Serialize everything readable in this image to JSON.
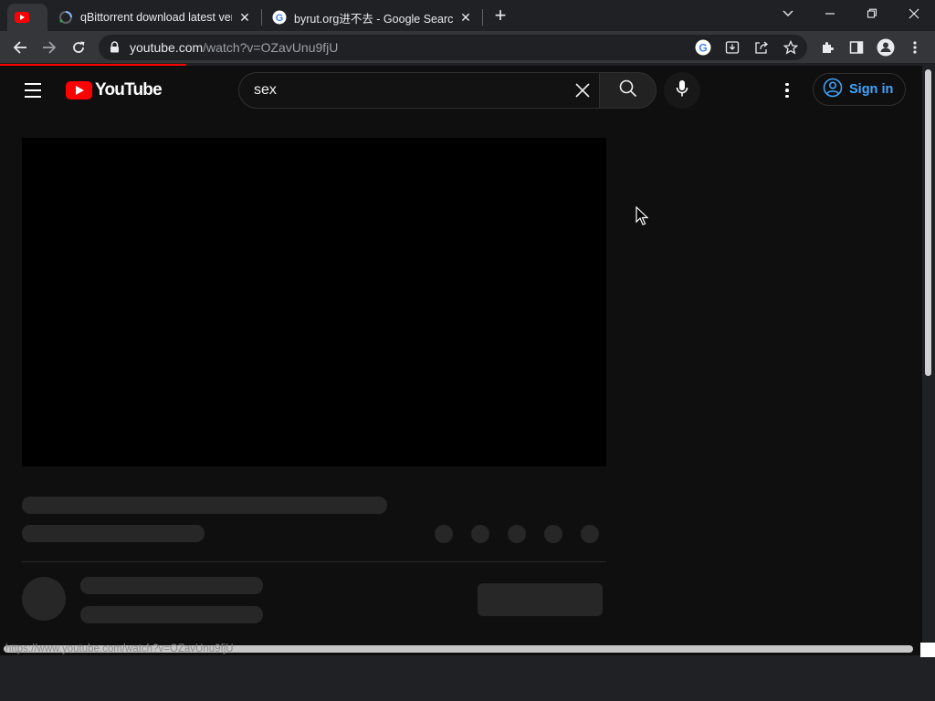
{
  "browser": {
    "tabs": [
      {
        "title": "",
        "active": true,
        "favicon": "youtube-icon"
      },
      {
        "title": "qBittorrent download latest versi",
        "active": false,
        "favicon": "loading-icon"
      },
      {
        "title": "byrut.org进不去 - Google Search",
        "active": false,
        "favicon": "google-icon"
      }
    ],
    "address": {
      "host": "youtube.com",
      "path": "/watch?v=OZavUnu9fjU"
    },
    "status_url": "https://www.youtube.com/watch?v=OZavUnu9fjU"
  },
  "youtube": {
    "logo_text": "YouTube",
    "search": {
      "query": "sex"
    },
    "signin_label": "Sign in"
  },
  "colors": {
    "accent_red": "#ff0000",
    "signin_blue": "#3ea6ff",
    "page_bg": "#0f0f0f",
    "skeleton": "#272727"
  }
}
